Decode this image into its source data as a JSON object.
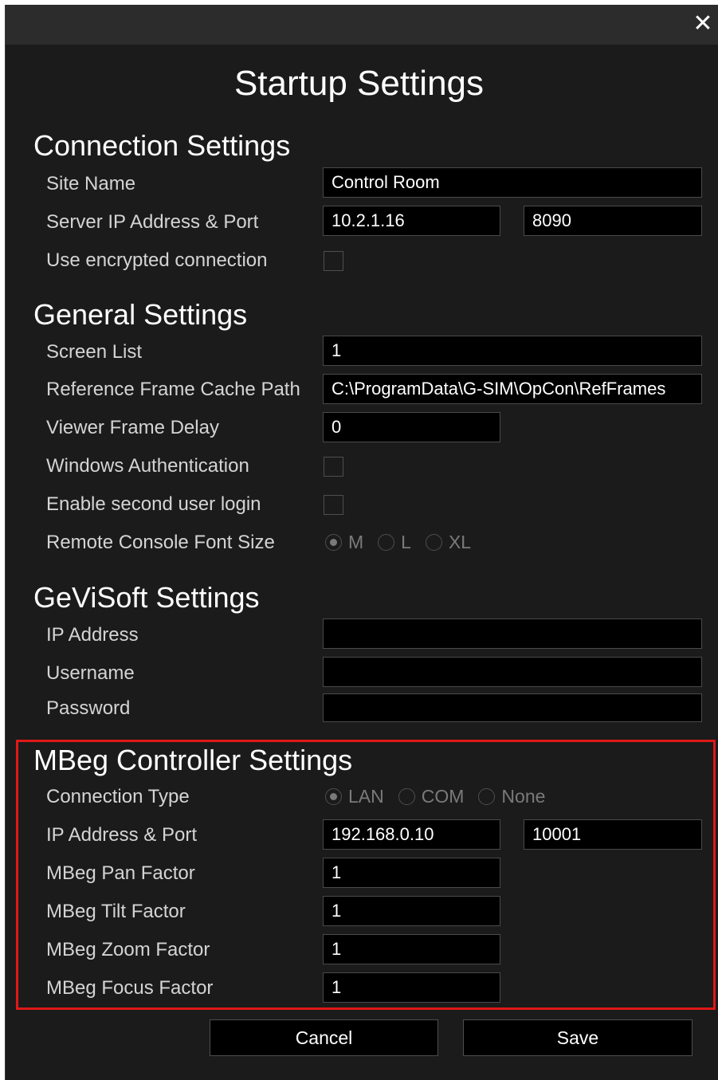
{
  "window": {
    "title": "Startup Settings",
    "close_glyph": "✕"
  },
  "connection": {
    "heading": "Connection Settings",
    "site_name_label": "Site Name",
    "site_name_value": "Control Room",
    "server_label": "Server IP Address & Port",
    "server_ip": "10.2.1.16",
    "server_port": "8090",
    "encrypted_label": "Use encrypted connection",
    "encrypted_checked": false
  },
  "general": {
    "heading": "General Settings",
    "screen_list_label": "Screen List",
    "screen_list_value": "1",
    "ref_cache_label": "Reference Frame Cache Path",
    "ref_cache_value": "C:\\ProgramData\\G-SIM\\OpCon\\RefFrames",
    "frame_delay_label": "Viewer Frame Delay",
    "frame_delay_value": "0",
    "windows_auth_label": "Windows Authentication",
    "windows_auth_checked": false,
    "second_login_label": "Enable second user login",
    "second_login_checked": false,
    "font_size_label": "Remote Console Font Size",
    "font_size_options": [
      "M",
      "L",
      "XL"
    ],
    "font_size_selected": "M"
  },
  "gevisoft": {
    "heading": "GeViSoft Settings",
    "ip_label": "IP Address",
    "ip_value": "",
    "username_label": "Username",
    "username_value": "",
    "password_label": "Password",
    "password_value": ""
  },
  "mbeg": {
    "heading": "MBeg Controller Settings",
    "connection_type_label": "Connection Type",
    "connection_type_options": [
      "LAN",
      "COM",
      "None"
    ],
    "connection_type_selected": "LAN",
    "ip_port_label": "IP Address & Port",
    "ip_value": "192.168.0.10",
    "port_value": "10001",
    "pan_label": "MBeg Pan Factor",
    "pan_value": "1",
    "tilt_label": "MBeg Tilt Factor",
    "tilt_value": "1",
    "zoom_label": "MBeg Zoom Factor",
    "zoom_value": "1",
    "focus_label": "MBeg Focus Factor",
    "focus_value": "1",
    "highlight_color": "#e01818"
  },
  "buttons": {
    "cancel": "Cancel",
    "save": "Save"
  }
}
